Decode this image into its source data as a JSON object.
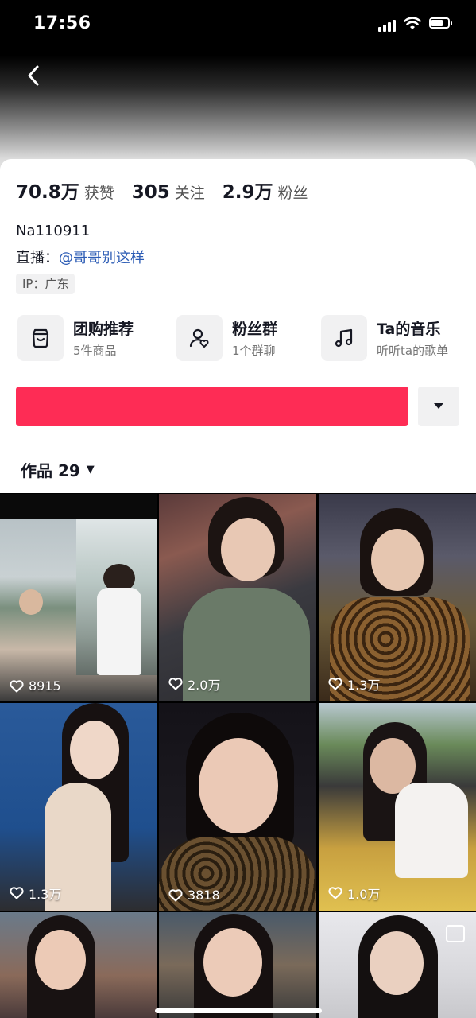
{
  "status_bar": {
    "time": "17:56",
    "signal_icon": "cellular-signal-icon",
    "wifi_icon": "wifi-icon",
    "battery_icon": "battery-icon"
  },
  "nav": {
    "back_icon": "chevron-left-icon"
  },
  "profile": {
    "stats": [
      {
        "value": "70.8万",
        "label": "获赞"
      },
      {
        "value": "305",
        "label": "关注"
      },
      {
        "value": "2.9万",
        "label": "粉丝"
      }
    ],
    "username": "Na110911",
    "live_prefix": "直播：",
    "live_link": "@哥哥别这样",
    "ip": "IP：广东"
  },
  "features": [
    {
      "title": "团购推荐",
      "subtitle": "5件商品",
      "icon": "shopping-bag-icon"
    },
    {
      "title": "粉丝群",
      "subtitle": "1个群聊",
      "icon": "fan-group-icon"
    },
    {
      "title": "Ta的音乐",
      "subtitle": "听听ta的歌单",
      "icon": "music-note-icon"
    }
  ],
  "actions": {
    "follow_label": "",
    "dropdown_icon": "caret-down-icon"
  },
  "works_tab": {
    "label": "作品 29",
    "caret_icon": "caret-down-icon"
  },
  "videos": [
    {
      "likes": "8915"
    },
    {
      "likes": "2.0万"
    },
    {
      "likes": "1.3万"
    },
    {
      "likes": "1.3万"
    },
    {
      "likes": "3818"
    },
    {
      "likes": "1.0万"
    },
    {
      "likes": ""
    },
    {
      "likes": ""
    },
    {
      "likes": ""
    }
  ],
  "colors": {
    "accent": "#fe2c55",
    "link": "#2c5cb5",
    "chip_bg": "#f1f1f2",
    "text": "#161823"
  }
}
